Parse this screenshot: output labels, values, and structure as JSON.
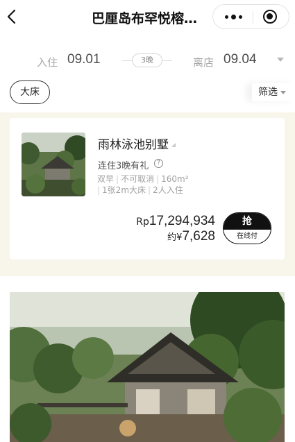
{
  "nav": {
    "title": "巴厘岛布罕悦榕…",
    "back_icon": "back-chevron-icon",
    "more_icon": "more-dots-icon",
    "close_icon": "target-circle-icon"
  },
  "dates": {
    "checkin_label": "入住",
    "checkin_date": "09.01",
    "nights": "3晚",
    "checkout_label": "离店",
    "checkout_date": "09.04"
  },
  "filters": {
    "bed_chip": "大床",
    "screen_label": "筛选"
  },
  "room": {
    "name": "雨林泳池别墅",
    "gift_text": "连住3晚有礼",
    "tags_line1": [
      "双早",
      "不可取消",
      "160m²"
    ],
    "tags_line2": [
      "1张2m大床",
      "2人入住"
    ],
    "price_currency": "Rp",
    "price_value": "17,294,934",
    "approx_label": "约¥",
    "approx_value": "7,628",
    "book_label": "抢",
    "book_sub": "在线付"
  },
  "colors": {
    "section_bg": "#f8f5ea",
    "button_dark": "#111111",
    "muted_text": "#a0a0a0"
  }
}
